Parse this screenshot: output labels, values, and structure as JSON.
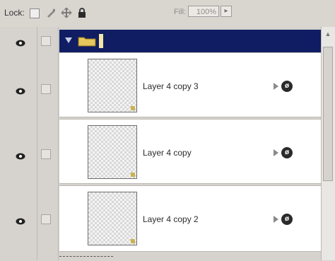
{
  "toolbar": {
    "lock_label": "Lock:",
    "fill_label": "Fill:",
    "fill_value": "100%",
    "fill_arrow": "▸",
    "icons": [
      "lock-transparent-pixels-icon",
      "lock-image-pixels-icon",
      "lock-position-icon",
      "lock-all-icon"
    ]
  },
  "group": {
    "name": "",
    "expanded": true,
    "icon": "folder-icon"
  },
  "layers": [
    {
      "name": "Layer 4 copy 3"
    },
    {
      "name": "Layer 4 copy"
    },
    {
      "name": "Layer 4 copy 2"
    }
  ],
  "fx_symbol": "ø",
  "colors": {
    "group_highlight": "#101d63",
    "panel_bg": "#d6d3ce"
  }
}
